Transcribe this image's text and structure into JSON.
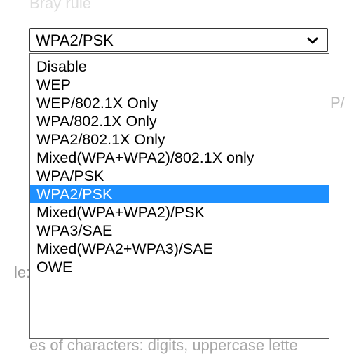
{
  "background": {
    "top_text": "Bray rule",
    "right_text": "P/",
    "left_text": "le:",
    "bottom_text": "es of characters: digits, uppercase lette"
  },
  "select": {
    "value": "WPA2/PSK",
    "icon": "chevron-down-icon"
  },
  "dropdown": {
    "options": [
      {
        "label": "Disable",
        "selected": false
      },
      {
        "label": "WEP",
        "selected": false
      },
      {
        "label": "WEP/802.1X Only",
        "selected": false
      },
      {
        "label": "WPA/802.1X Only",
        "selected": false
      },
      {
        "label": "WPA2/802.1X Only",
        "selected": false
      },
      {
        "label": "Mixed(WPA+WPA2)/802.1X only",
        "selected": false
      },
      {
        "label": "WPA/PSK",
        "selected": false
      },
      {
        "label": "WPA2/PSK",
        "selected": true
      },
      {
        "label": "Mixed(WPA+WPA2)/PSK",
        "selected": false
      },
      {
        "label": "WPA3/SAE",
        "selected": false
      },
      {
        "label": "Mixed(WPA2+WPA3)/SAE",
        "selected": false
      },
      {
        "label": "OWE",
        "selected": false
      }
    ]
  },
  "colors": {
    "highlight": "#1e90ff",
    "highlight_text": "#ffffff",
    "dropdown_border": "#5a5a5a"
  }
}
